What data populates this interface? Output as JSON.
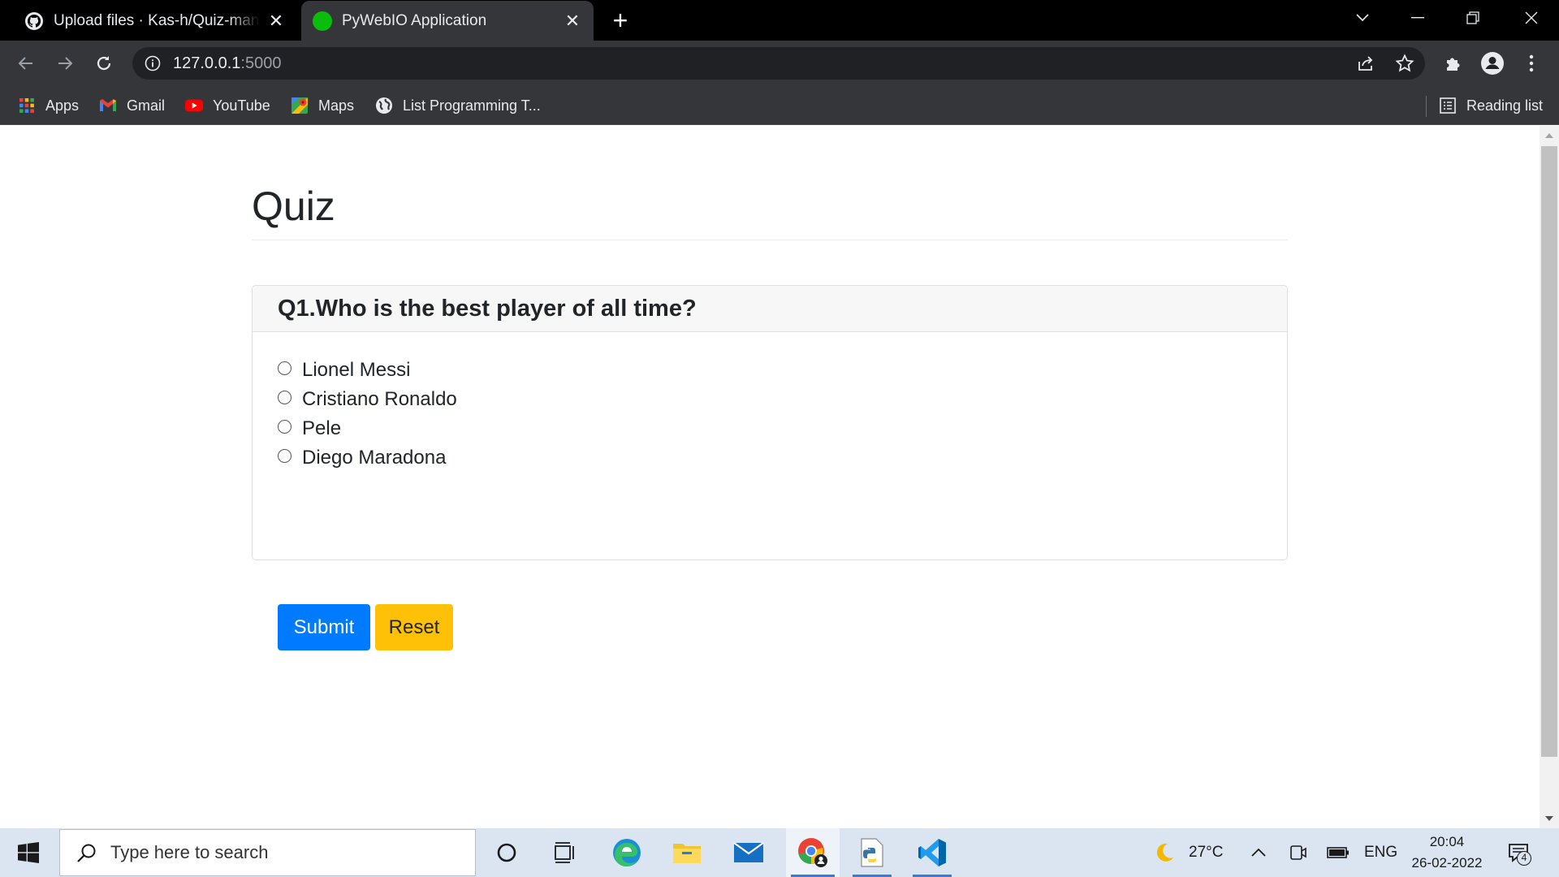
{
  "browser": {
    "tabs": [
      {
        "title": "Upload files · Kas-h/Quiz-management-system",
        "active": false,
        "favicon": "github-icon"
      },
      {
        "title": "PyWebIO Application",
        "active": true,
        "favicon": "green-circle-icon",
        "favicon_color": "#0bbd0b"
      }
    ],
    "new_tab_label": "+",
    "address": {
      "host": "127.0.0.1",
      "port": ":5000"
    },
    "bookmarks": [
      {
        "label": "Apps",
        "icon": "apps-grid-icon"
      },
      {
        "label": "Gmail",
        "icon": "gmail-icon"
      },
      {
        "label": "YouTube",
        "icon": "youtube-icon"
      },
      {
        "label": "Maps",
        "icon": "maps-icon"
      },
      {
        "label": "List Programming T...",
        "icon": "globe-icon"
      }
    ],
    "reading_list": "Reading list"
  },
  "page": {
    "heading": "Quiz",
    "question": "Q1.Who is the best player of all time?",
    "options": [
      "Lionel Messi",
      "Cristiano Ronaldo",
      "Pele",
      "Diego Maradona"
    ],
    "submit_label": "Submit",
    "reset_label": "Reset",
    "colors": {
      "primary": "#007bff",
      "warning": "#ffc107"
    }
  },
  "taskbar": {
    "search_placeholder": "Type here to search",
    "weather_temp": "27°C",
    "language": "ENG",
    "time": "20:04",
    "date": "26-02-2022",
    "notification_count": "4"
  }
}
